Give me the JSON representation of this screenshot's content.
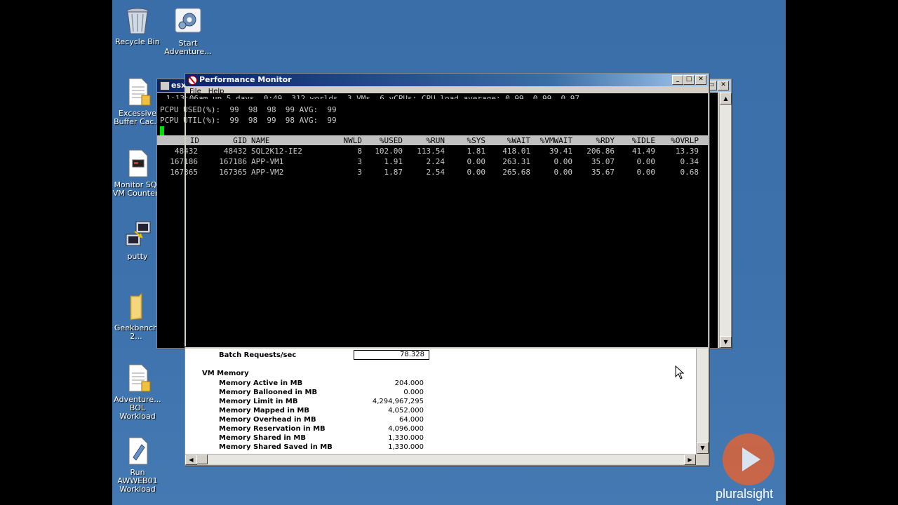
{
  "desktop_icons": [
    {
      "name": "recycle-bin",
      "label": "Recycle Bin",
      "icon": "recycle-bin-icon"
    },
    {
      "name": "start-adventure",
      "label": "Start\nAdventure...",
      "icon": "settings-shortcut-icon"
    },
    {
      "name": "excessive-buffer",
      "label": "Excessive\nBuffer Cac...",
      "icon": "document-icon"
    },
    {
      "name": "monitor-sql",
      "label": "Monitor SQL\nVM Counters",
      "icon": "document-icon"
    },
    {
      "name": "putty",
      "label": "putty",
      "icon": "putty-icon"
    },
    {
      "name": "geekbench",
      "label": "Geekbench 2...",
      "icon": "folder-icon"
    },
    {
      "name": "adventure-bol",
      "label": "Adventure...\nBOL Workload",
      "icon": "document-icon"
    },
    {
      "name": "run-awweb01",
      "label": "Run AWWEB01\nWorkload",
      "icon": "script-icon"
    }
  ],
  "esx_window": {
    "title": "esx"
  },
  "perfmon": {
    "title": "Performance Monitor",
    "menu": [
      "File",
      "Help"
    ]
  },
  "esxtop": {
    "uptime_line": " 1:13:06am up 5 days  0:49, 312 worlds, 3 VMs, 6 vCPUs; CPU load average: 0.99, 0.99, 0.97",
    "pcpu_used": "PCPU USED(%):  99  98  98  99 AVG:  99",
    "pcpu_util": "PCPU UTIL(%):  99  98  99  98 AVG:  99",
    "columns": [
      "ID",
      "GID",
      "NAME",
      "NWLD",
      "%USED",
      "%RUN",
      "%SYS",
      "%WAIT",
      "%VMWAIT",
      "%RDY",
      "%IDLE",
      "%OVRLP"
    ],
    "rows": [
      [
        "48432",
        "48432",
        "SQL2K12-IE2",
        "8",
        "102.00",
        "113.54",
        "1.81",
        "418.01",
        "39.41",
        "206.86",
        "41.49",
        "13.39"
      ],
      [
        "167186",
        "167186",
        "APP-VM1",
        "3",
        "1.91",
        "2.24",
        "0.00",
        "263.31",
        "0.00",
        "35.07",
        "0.00",
        "0.34"
      ],
      [
        "167365",
        "167365",
        "APP-VM2",
        "3",
        "1.87",
        "2.54",
        "0.00",
        "265.68",
        "0.00",
        "35.67",
        "0.00",
        "0.68"
      ]
    ]
  },
  "counters": {
    "batch_label": "Batch Requests/sec",
    "batch_value": "78.328",
    "group_label": "VM Memory",
    "items": [
      {
        "label": "Memory Active in MB",
        "value": "204.000"
      },
      {
        "label": "Memory Ballooned in MB",
        "value": "0.000"
      },
      {
        "label": "Memory Limit in MB",
        "value": "4,294,967,295"
      },
      {
        "label": "Memory Mapped in MB",
        "value": "4,052.000"
      },
      {
        "label": "Memory Overhead in MB",
        "value": "64.000"
      },
      {
        "label": "Memory Reservation in MB",
        "value": "4,096.000"
      },
      {
        "label": "Memory Shared in MB",
        "value": "1,330.000"
      },
      {
        "label": "Memory Shared Saved in MB",
        "value": "1,330.000"
      }
    ]
  },
  "watermark": {
    "brand": "pluralsight",
    "accent": "#e8622f"
  }
}
